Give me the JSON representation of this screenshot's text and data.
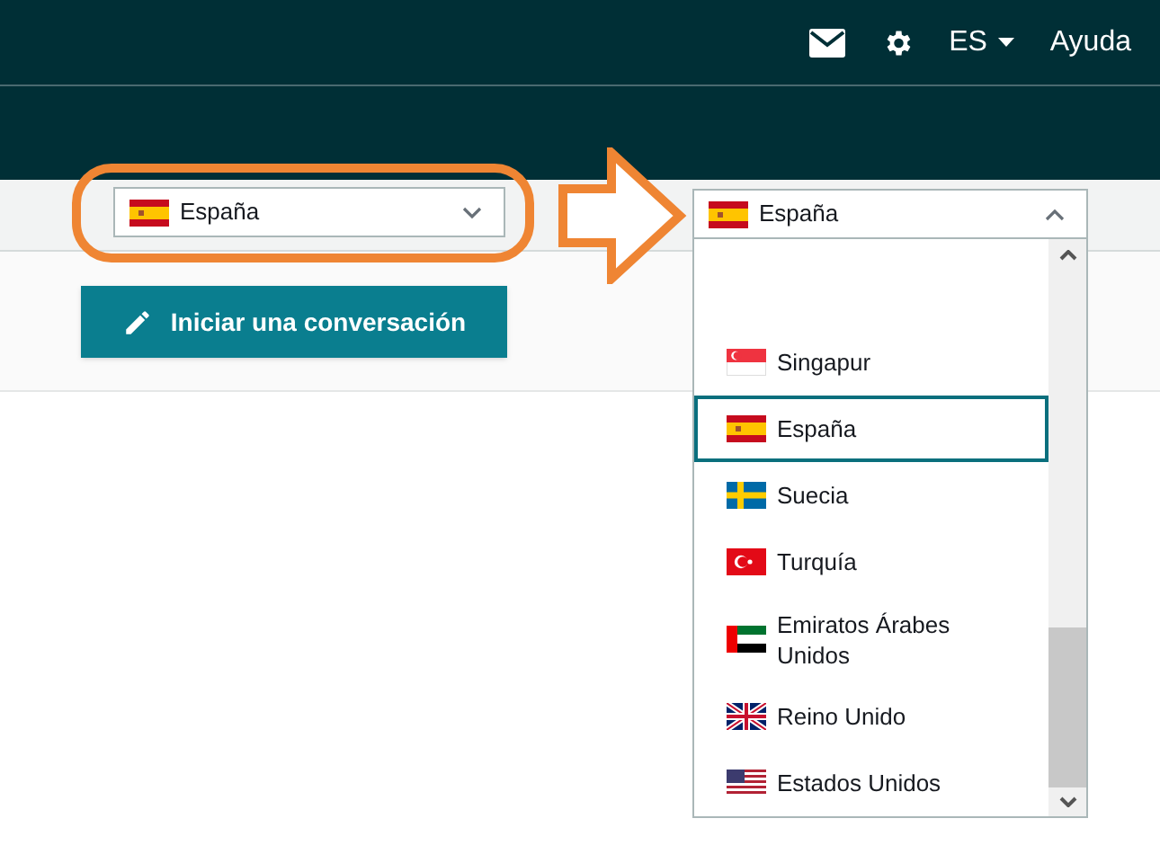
{
  "top_bar": {
    "language": "ES",
    "help": "Ayuda"
  },
  "country_select": {
    "value": "España",
    "kind": "spain"
  },
  "start_button": {
    "label": "Iniciar una conversación"
  },
  "open_select": {
    "value": "España",
    "kind": "spain",
    "expanded": true,
    "options": [
      {
        "label": "Singapur",
        "kind": "singapore",
        "selected": false
      },
      {
        "label": "España",
        "kind": "spain",
        "selected": true
      },
      {
        "label": "Suecia",
        "kind": "sweden",
        "selected": false
      },
      {
        "label": "Turquía",
        "kind": "turkey",
        "selected": false
      },
      {
        "label": "Emiratos Árabes Unidos",
        "kind": "uae",
        "selected": false
      },
      {
        "label": "Reino Unido",
        "kind": "uk",
        "selected": false
      },
      {
        "label": "Estados Unidos",
        "kind": "usa",
        "selected": false
      }
    ]
  }
}
